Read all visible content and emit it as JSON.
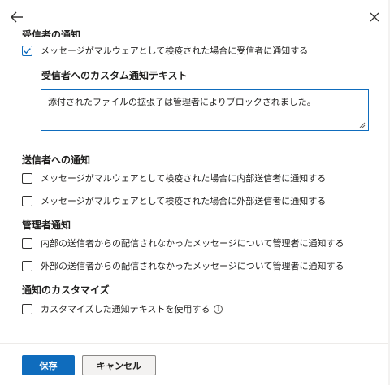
{
  "header": {
    "back_label": "back",
    "close_label": "close"
  },
  "recipient_section": {
    "title": "受信者の通知",
    "checkbox_label": "メッセージがマルウェアとして検疫された場合に受信者に通知する",
    "checked": true,
    "custom_text_label": "受信者へのカスタム通知テキスト",
    "custom_text_value": "添付されたファイルの拡張子は管理者によりブロックされました。"
  },
  "sender_section": {
    "title": "送信者への通知",
    "items": [
      {
        "label": "メッセージがマルウェアとして検疫された場合に内部送信者に通知する",
        "checked": false
      },
      {
        "label": "メッセージがマルウェアとして検疫された場合に外部送信者に通知する",
        "checked": false
      }
    ]
  },
  "admin_section": {
    "title": "管理者通知",
    "items": [
      {
        "label": "内部の送信者からの配信されなかったメッセージについて管理者に通知する",
        "checked": false
      },
      {
        "label": "外部の送信者からの配信されなかったメッセージについて管理者に通知する",
        "checked": false
      }
    ]
  },
  "customize_section": {
    "title": "通知のカスタマイズ",
    "checkbox_label": "カスタマイズした通知テキストを使用する",
    "checked": false,
    "info_icon": "info-icon"
  },
  "footer": {
    "save_label": "保存",
    "cancel_label": "キャンセル"
  },
  "colors": {
    "accent": "#0f6cbd",
    "text": "#201f1e",
    "border": "#323130"
  }
}
